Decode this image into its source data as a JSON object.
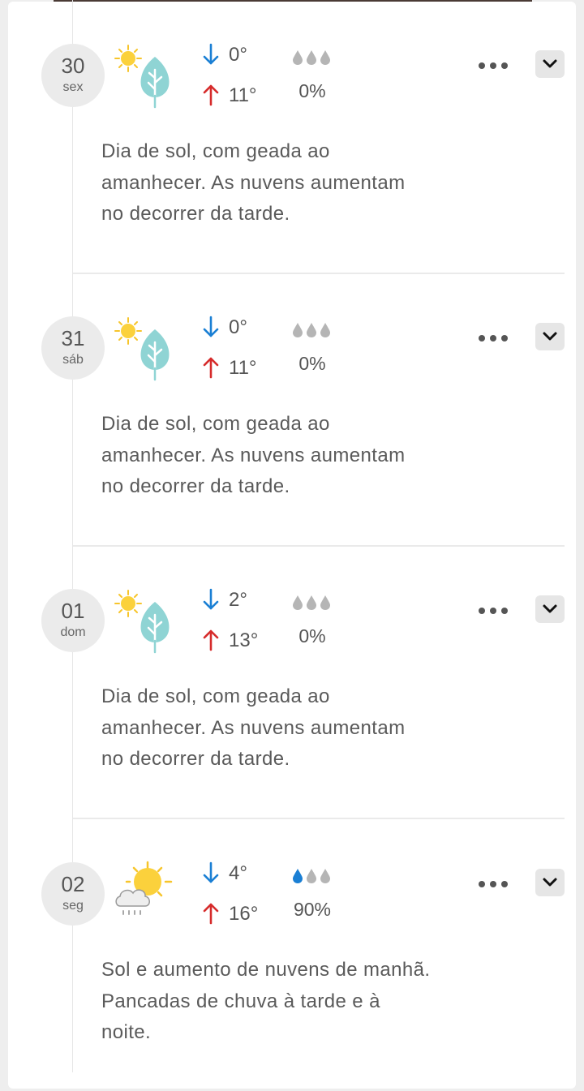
{
  "days": [
    {
      "day": "30",
      "weekday": "sex",
      "icon": "sun-frost-icon",
      "low": "0°",
      "high": "11°",
      "rain_pct": "0%",
      "rain_level": 0,
      "desc": [
        "Dia de sol, com geada ao",
        "amanhecer. As nuvens aumentam",
        "no decorrer da tarde."
      ]
    },
    {
      "day": "31",
      "weekday": "sáb",
      "icon": "sun-frost-icon",
      "low": "0°",
      "high": "11°",
      "rain_pct": "0%",
      "rain_level": 0,
      "desc": [
        "Dia de sol, com geada ao",
        "amanhecer. As nuvens aumentam",
        "no decorrer da tarde."
      ]
    },
    {
      "day": "01",
      "weekday": "dom",
      "icon": "sun-frost-icon",
      "low": "2°",
      "high": "13°",
      "rain_pct": "0%",
      "rain_level": 0,
      "desc": [
        "Dia de sol, com geada ao",
        "amanhecer. As nuvens aumentam",
        "no decorrer da tarde."
      ]
    },
    {
      "day": "02",
      "weekday": "seg",
      "icon": "sun-cloud-rain-icon",
      "low": "4°",
      "high": "16°",
      "rain_pct": "90%",
      "rain_level": 1,
      "desc": [
        "Sol e aumento de nuvens de manhã.",
        "Pancadas de chuva à tarde e à",
        "noite."
      ]
    }
  ],
  "colors": {
    "low_arrow": "#1a7fd4",
    "high_arrow": "#d62b2b",
    "drop_inactive": "#b5b5b5",
    "drop_active": "#1a7fd4",
    "leaf": "#8fd4d4",
    "sun": "#fbd13c"
  }
}
